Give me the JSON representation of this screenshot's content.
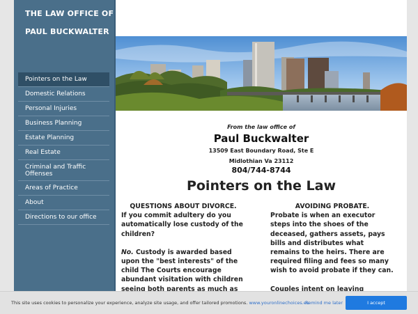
{
  "site_title": {
    "line1": "THE LAW OFFICE OF",
    "line2": "PAUL BUCKWALTER"
  },
  "nav": [
    {
      "label": "Pointers on the Law",
      "active": true
    },
    {
      "label": "Domestic Relations"
    },
    {
      "label": "Personal Injuries"
    },
    {
      "label": "Business Planning"
    },
    {
      "label": "Estate Planning"
    },
    {
      "label": "Real Estate"
    },
    {
      "label": "Criminal and Traffic Offenses"
    },
    {
      "label": "Areas of Practice"
    },
    {
      "label": "About"
    },
    {
      "label": "Directions to our office"
    }
  ],
  "header": {
    "from": "From the law office of",
    "name": "Paul Buckwalter",
    "address1": "13509 East Boundary Road, Ste E",
    "address2": "Midlothian Va 23112",
    "phone": "804/744-8744"
  },
  "page_title": "Pointers on the Law",
  "left_col": {
    "heading": "QUESTIONS ABOUT DIVORCE.",
    "q": "If you commit adultery do you automatically lose custody of the children?",
    "no": "No.",
    "a": " Custody is awarded based upon the \"best interests\" of the child  The Courts encourage abundant visitation with children seeing both parents as much as is reasonable."
  },
  "right_col": {
    "heading": "AVOIDING  PROBATE.",
    "p1": "Probate is when an executor steps into the shoes of the deceased, gathers assets, pays bills and distributes what remains to the heirs.  There are required filing and fees so many wish to avoid probate if they can.",
    "p2": "Couples intent on leaving everything"
  },
  "cookie": {
    "message": "This site uses cookies to personalize your experience, analyze site usage, and offer tailored promotions.",
    "link": "www.youronlinechoices.eu",
    "remind": "Remind me later",
    "accept": "I accept"
  }
}
